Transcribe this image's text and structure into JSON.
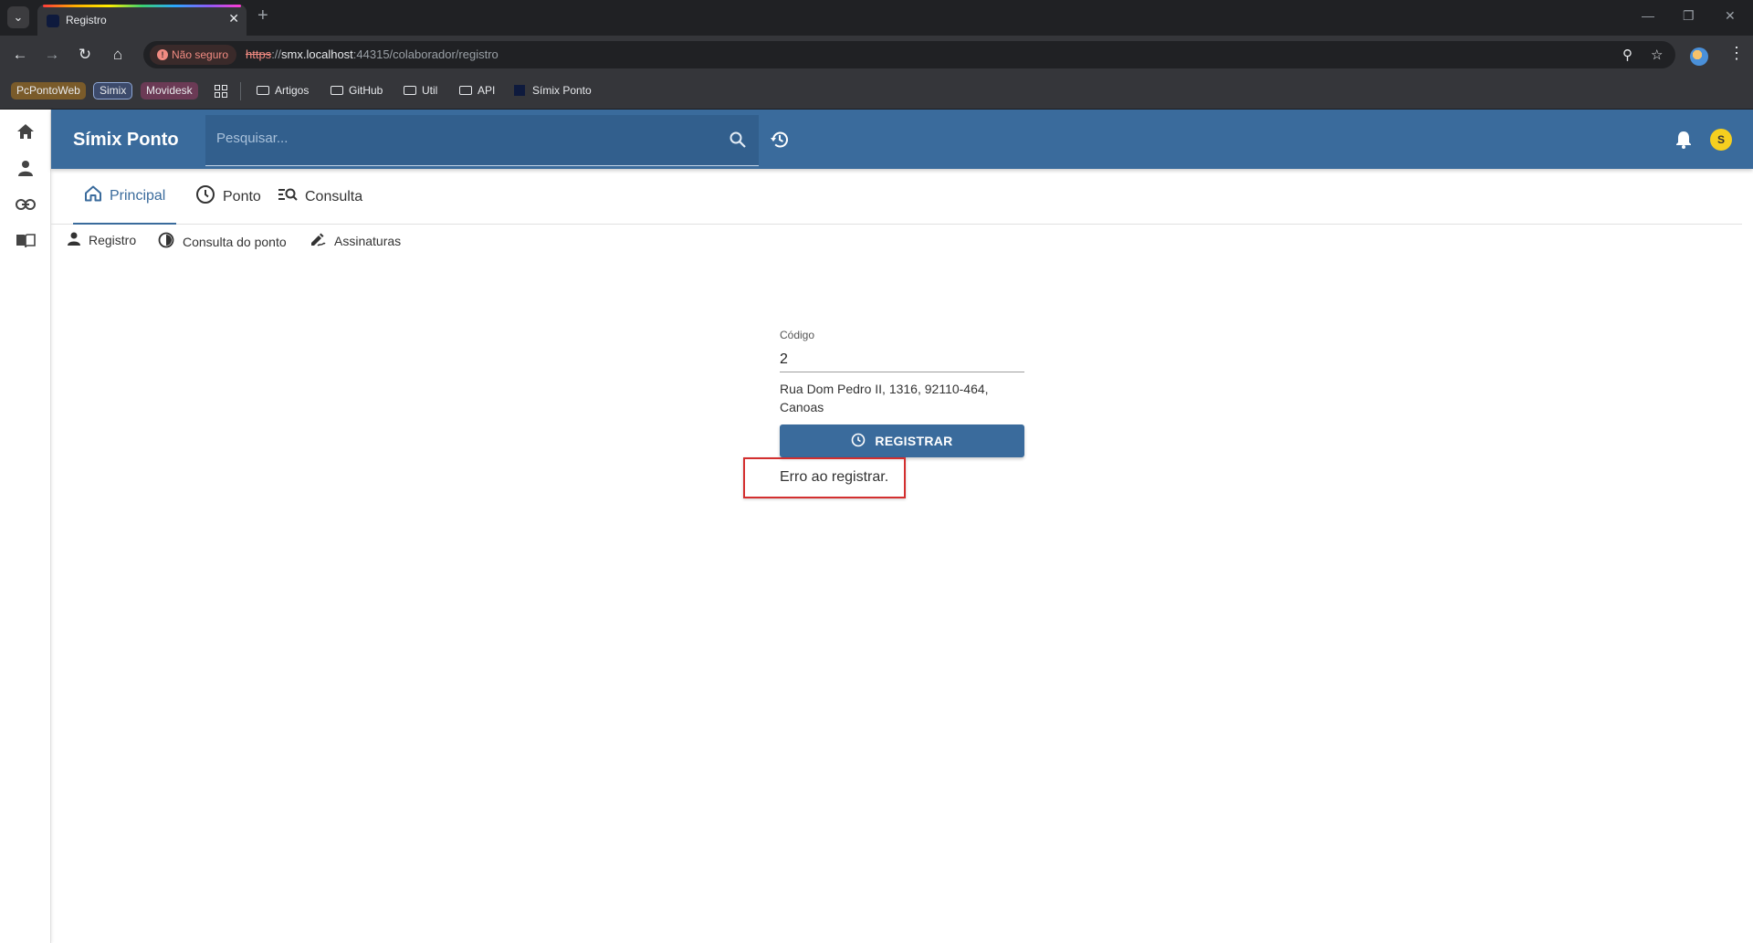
{
  "browser": {
    "tab_title": "Registro",
    "security_label": "Não seguro",
    "url_scheme": "https",
    "url_sep": "://",
    "url_host": "smx.localhost",
    "url_rest": ":44315/colaborador/registro",
    "bookmarks": {
      "badges": [
        {
          "label": "PcPontoWeb",
          "color": "#7a5b2a"
        },
        {
          "label": "Simix",
          "color": "#3c4a6b"
        },
        {
          "label": "Movidesk",
          "color": "#6b3a55"
        }
      ],
      "folders": [
        "Artigos",
        "GitHub",
        "Util",
        "API"
      ],
      "site": "Símix Ponto"
    }
  },
  "app": {
    "title": "Símix Ponto",
    "search_placeholder": "Pesquisar...",
    "avatar_initial": "S",
    "accent_color": "#3a6b9c",
    "tabs": [
      {
        "label": "Principal",
        "icon": "home-outline-icon",
        "active": true
      },
      {
        "label": "Ponto",
        "icon": "clock-icon",
        "active": false
      },
      {
        "label": "Consulta",
        "icon": "search-list-icon",
        "active": false
      }
    ],
    "subnav": [
      {
        "label": "Registro",
        "icon": "person-icon"
      },
      {
        "label": "Consulta do ponto",
        "icon": "contrast-icon"
      },
      {
        "label": "Assinaturas",
        "icon": "signature-icon"
      }
    ],
    "sidebar_icons": [
      "home-icon",
      "person-icon",
      "link-icon",
      "book-icon"
    ]
  },
  "form": {
    "code_label": "Código",
    "code_value": "2",
    "address_line1": "Rua Dom Pedro II, 1316, 92110-464,",
    "address_line2": "Canoas",
    "register_label": "REGISTRAR",
    "error_message": "Erro ao registrar."
  }
}
